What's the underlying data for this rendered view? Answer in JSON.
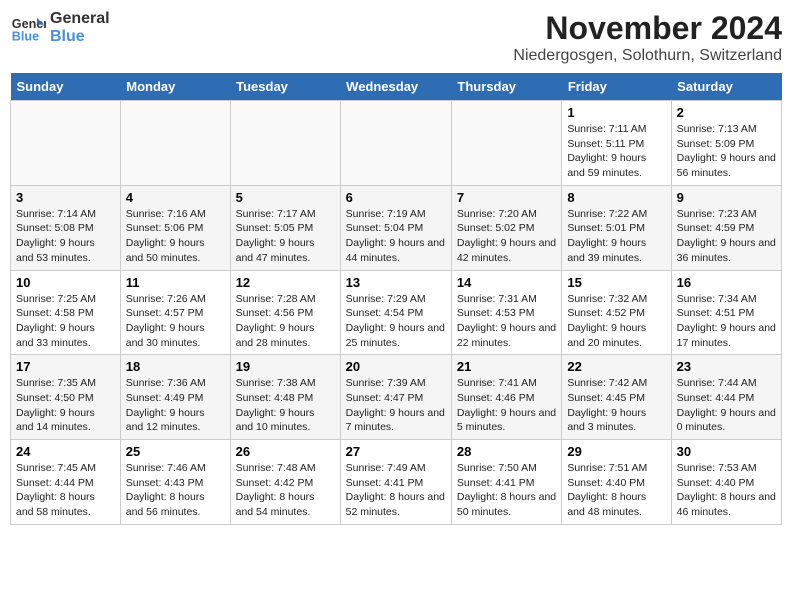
{
  "logo": {
    "line1": "General",
    "line2": "Blue"
  },
  "title": "November 2024",
  "subtitle": "Niedergosgen, Solothurn, Switzerland",
  "days_of_week": [
    "Sunday",
    "Monday",
    "Tuesday",
    "Wednesday",
    "Thursday",
    "Friday",
    "Saturday"
  ],
  "weeks": [
    [
      {
        "day": "",
        "info": ""
      },
      {
        "day": "",
        "info": ""
      },
      {
        "day": "",
        "info": ""
      },
      {
        "day": "",
        "info": ""
      },
      {
        "day": "",
        "info": ""
      },
      {
        "day": "1",
        "info": "Sunrise: 7:11 AM\nSunset: 5:11 PM\nDaylight: 9 hours and 59 minutes."
      },
      {
        "day": "2",
        "info": "Sunrise: 7:13 AM\nSunset: 5:09 PM\nDaylight: 9 hours and 56 minutes."
      }
    ],
    [
      {
        "day": "3",
        "info": "Sunrise: 7:14 AM\nSunset: 5:08 PM\nDaylight: 9 hours and 53 minutes."
      },
      {
        "day": "4",
        "info": "Sunrise: 7:16 AM\nSunset: 5:06 PM\nDaylight: 9 hours and 50 minutes."
      },
      {
        "day": "5",
        "info": "Sunrise: 7:17 AM\nSunset: 5:05 PM\nDaylight: 9 hours and 47 minutes."
      },
      {
        "day": "6",
        "info": "Sunrise: 7:19 AM\nSunset: 5:04 PM\nDaylight: 9 hours and 44 minutes."
      },
      {
        "day": "7",
        "info": "Sunrise: 7:20 AM\nSunset: 5:02 PM\nDaylight: 9 hours and 42 minutes."
      },
      {
        "day": "8",
        "info": "Sunrise: 7:22 AM\nSunset: 5:01 PM\nDaylight: 9 hours and 39 minutes."
      },
      {
        "day": "9",
        "info": "Sunrise: 7:23 AM\nSunset: 4:59 PM\nDaylight: 9 hours and 36 minutes."
      }
    ],
    [
      {
        "day": "10",
        "info": "Sunrise: 7:25 AM\nSunset: 4:58 PM\nDaylight: 9 hours and 33 minutes."
      },
      {
        "day": "11",
        "info": "Sunrise: 7:26 AM\nSunset: 4:57 PM\nDaylight: 9 hours and 30 minutes."
      },
      {
        "day": "12",
        "info": "Sunrise: 7:28 AM\nSunset: 4:56 PM\nDaylight: 9 hours and 28 minutes."
      },
      {
        "day": "13",
        "info": "Sunrise: 7:29 AM\nSunset: 4:54 PM\nDaylight: 9 hours and 25 minutes."
      },
      {
        "day": "14",
        "info": "Sunrise: 7:31 AM\nSunset: 4:53 PM\nDaylight: 9 hours and 22 minutes."
      },
      {
        "day": "15",
        "info": "Sunrise: 7:32 AM\nSunset: 4:52 PM\nDaylight: 9 hours and 20 minutes."
      },
      {
        "day": "16",
        "info": "Sunrise: 7:34 AM\nSunset: 4:51 PM\nDaylight: 9 hours and 17 minutes."
      }
    ],
    [
      {
        "day": "17",
        "info": "Sunrise: 7:35 AM\nSunset: 4:50 PM\nDaylight: 9 hours and 14 minutes."
      },
      {
        "day": "18",
        "info": "Sunrise: 7:36 AM\nSunset: 4:49 PM\nDaylight: 9 hours and 12 minutes."
      },
      {
        "day": "19",
        "info": "Sunrise: 7:38 AM\nSunset: 4:48 PM\nDaylight: 9 hours and 10 minutes."
      },
      {
        "day": "20",
        "info": "Sunrise: 7:39 AM\nSunset: 4:47 PM\nDaylight: 9 hours and 7 minutes."
      },
      {
        "day": "21",
        "info": "Sunrise: 7:41 AM\nSunset: 4:46 PM\nDaylight: 9 hours and 5 minutes."
      },
      {
        "day": "22",
        "info": "Sunrise: 7:42 AM\nSunset: 4:45 PM\nDaylight: 9 hours and 3 minutes."
      },
      {
        "day": "23",
        "info": "Sunrise: 7:44 AM\nSunset: 4:44 PM\nDaylight: 9 hours and 0 minutes."
      }
    ],
    [
      {
        "day": "24",
        "info": "Sunrise: 7:45 AM\nSunset: 4:44 PM\nDaylight: 8 hours and 58 minutes."
      },
      {
        "day": "25",
        "info": "Sunrise: 7:46 AM\nSunset: 4:43 PM\nDaylight: 8 hours and 56 minutes."
      },
      {
        "day": "26",
        "info": "Sunrise: 7:48 AM\nSunset: 4:42 PM\nDaylight: 8 hours and 54 minutes."
      },
      {
        "day": "27",
        "info": "Sunrise: 7:49 AM\nSunset: 4:41 PM\nDaylight: 8 hours and 52 minutes."
      },
      {
        "day": "28",
        "info": "Sunrise: 7:50 AM\nSunset: 4:41 PM\nDaylight: 8 hours and 50 minutes."
      },
      {
        "day": "29",
        "info": "Sunrise: 7:51 AM\nSunset: 4:40 PM\nDaylight: 8 hours and 48 minutes."
      },
      {
        "day": "30",
        "info": "Sunrise: 7:53 AM\nSunset: 4:40 PM\nDaylight: 8 hours and 46 minutes."
      }
    ]
  ]
}
